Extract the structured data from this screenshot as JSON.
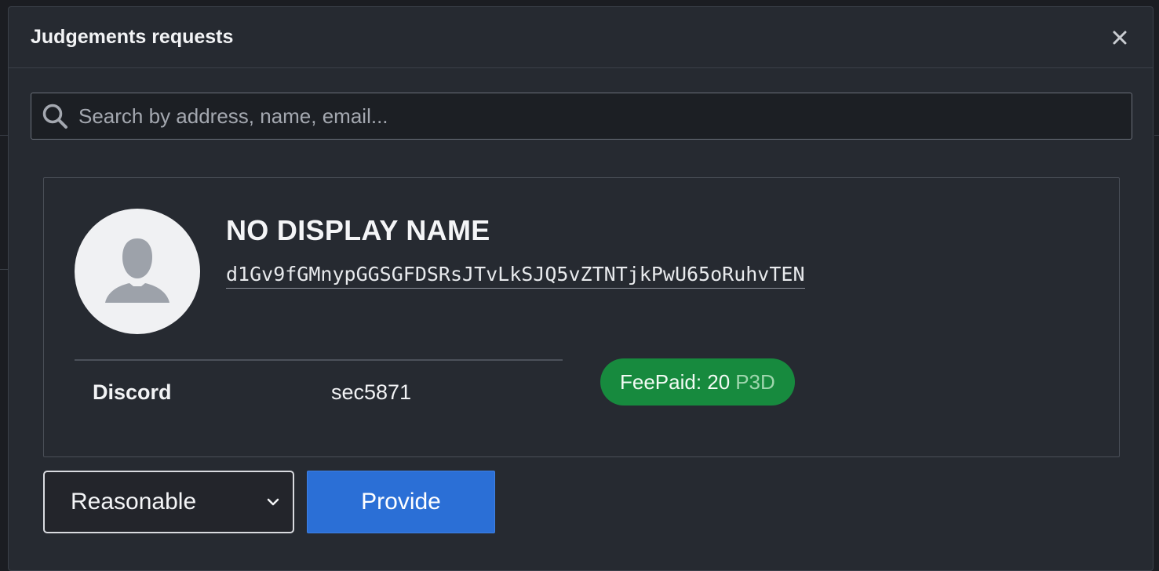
{
  "modal": {
    "title": "Judgements requests",
    "close_label": "×"
  },
  "search": {
    "placeholder": "Search by address, name, email...",
    "value": ""
  },
  "identity": {
    "display_name": "NO DISPLAY NAME",
    "address": "d1Gv9fGMnypGGSGFDSRsJTvLkSJQ5vZTNTjkPwU65oRuhvTEN",
    "fields": [
      {
        "label": "Discord",
        "value": "sec5871"
      }
    ],
    "fee": {
      "label": "FeePaid: 20",
      "unit": "P3D"
    }
  },
  "actions": {
    "judgement_select": {
      "selected": "Reasonable"
    },
    "provide_label": "Provide"
  },
  "colors": {
    "modal_bg": "#262a31",
    "badge_green": "#178a3e",
    "primary_blue": "#2b6fd6"
  }
}
